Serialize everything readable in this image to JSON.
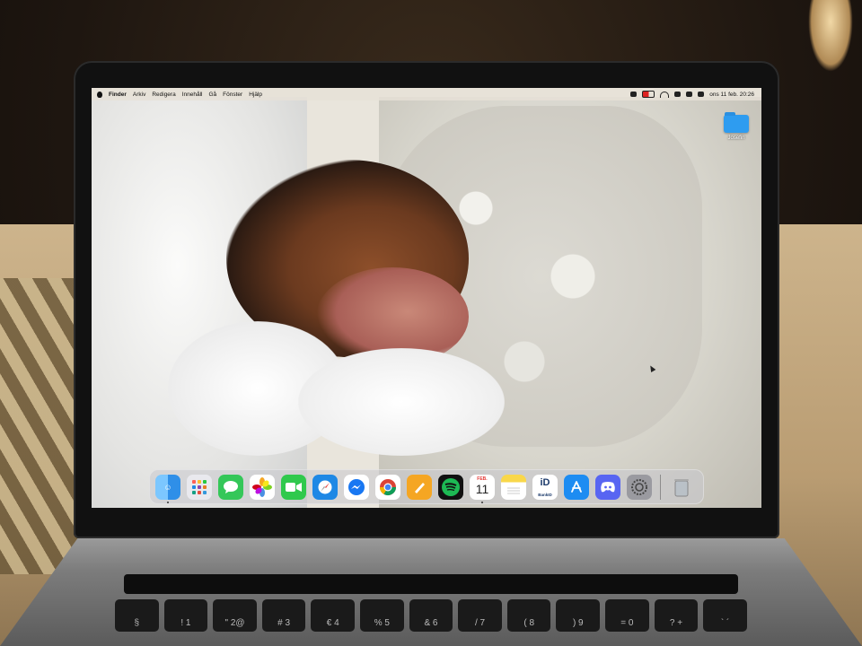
{
  "menubar": {
    "left_items": [
      "Finder",
      "Arkiv",
      "Redigera",
      "Innehåll",
      "Gå",
      "Fönster",
      "Hjälp"
    ],
    "clock": "ons 11 feb. 20:26"
  },
  "desktop": {
    "folder_label": "Josefin"
  },
  "dock": {
    "apps": [
      {
        "name": "Finder",
        "icon": "finder-icon",
        "color": "#2f8fe8"
      },
      {
        "name": "Launchpad",
        "icon": "launchpad-icon",
        "color": "#e9e9ee"
      },
      {
        "name": "Messages",
        "icon": "messages-icon",
        "color": "#34c759"
      },
      {
        "name": "Photos",
        "icon": "photos-icon",
        "color": "#ffffff"
      },
      {
        "name": "FaceTime",
        "icon": "facetime-icon",
        "color": "#2fc94d"
      },
      {
        "name": "Safari",
        "icon": "safari-icon",
        "color": "#1e88e5"
      },
      {
        "name": "Messenger",
        "icon": "messenger-icon",
        "color": "#ffffff"
      },
      {
        "name": "Chrome",
        "icon": "chrome-icon",
        "color": "#ffffff"
      },
      {
        "name": "Pages",
        "icon": "pages-icon",
        "color": "#f5a623"
      },
      {
        "name": "Spotify",
        "icon": "spotify-icon",
        "color": "#111111"
      },
      {
        "name": "Calendar",
        "icon": "calendar-icon",
        "color": "#ffffff"
      },
      {
        "name": "Notes",
        "icon": "notes-icon",
        "color": "#ffffff"
      },
      {
        "name": "BankID",
        "icon": "bankid-icon",
        "color": "#ffffff"
      },
      {
        "name": "App Store",
        "icon": "app-store-icon",
        "color": "#1d8cf2"
      },
      {
        "name": "Discord",
        "icon": "discord-icon",
        "color": "#5865f2"
      },
      {
        "name": "System Settings",
        "icon": "settings-icon",
        "color": "#9a9aa0"
      }
    ],
    "trash_icon": "trash-icon",
    "calendar": {
      "month": "FEB.",
      "day": "11"
    },
    "bankid_label": "BankID"
  },
  "keyboard": {
    "keys": [
      "§",
      "!\n1",
      "\"\n2@",
      "#\n3",
      "€\n4",
      "%\n5",
      "&\n6",
      "/\n7",
      "(\n8",
      ")\n9",
      "=\n0",
      "?\n+",
      "`\n´"
    ]
  }
}
